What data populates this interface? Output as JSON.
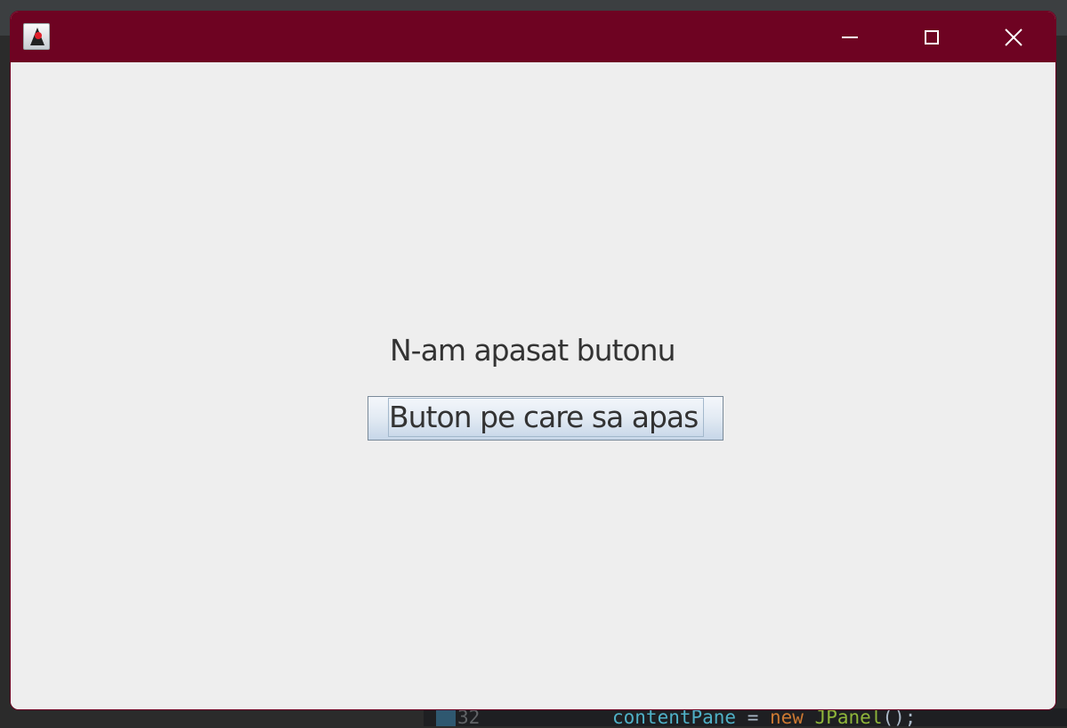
{
  "window": {
    "title_color": "#6e0322",
    "icon": "java-duke-icon",
    "controls": {
      "minimize": "minimize-icon",
      "maximize": "maximize-icon",
      "close": "close-icon"
    }
  },
  "main": {
    "status_label": "N-am apasat butonu",
    "button_label": "Buton pe care sa apas"
  },
  "background_editor": {
    "line_number": "32",
    "code": {
      "var": "contentPane",
      "op": " = ",
      "kw": "new",
      "cls": "JPanel",
      "tail": "();"
    }
  }
}
